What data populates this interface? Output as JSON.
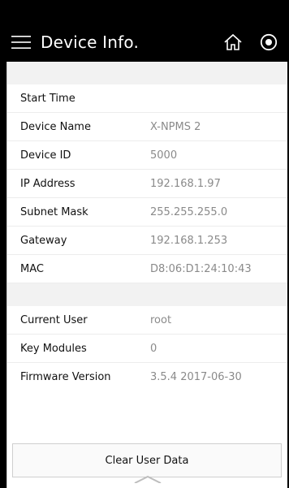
{
  "appbar": {
    "title": "Device Info.",
    "menu_icon": "menu-icon",
    "home_icon": "home-icon",
    "record_icon": "record-icon"
  },
  "rows_group_1": [
    {
      "label": "Start Time",
      "value": ""
    },
    {
      "label": "Device Name",
      "value": "X-NPMS 2"
    },
    {
      "label": "Device ID",
      "value": "5000"
    },
    {
      "label": "IP Address",
      "value": "192.168.1.97"
    },
    {
      "label": "Subnet Mask",
      "value": "255.255.255.0"
    },
    {
      "label": "Gateway",
      "value": "192.168.1.253"
    },
    {
      "label": "MAC",
      "value": "D8:06:D1:24:10:43"
    }
  ],
  "rows_group_2": [
    {
      "label": "Current User",
      "value": "root"
    },
    {
      "label": "Key Modules",
      "value": "0"
    },
    {
      "label": "Firmware Version",
      "value": "3.5.4 2017-06-30"
    }
  ],
  "actions": {
    "clear_label": "Clear User Data"
  },
  "colors": {
    "appbar_bg": "#000000",
    "label": "#111111",
    "value": "#8a8a8a"
  }
}
